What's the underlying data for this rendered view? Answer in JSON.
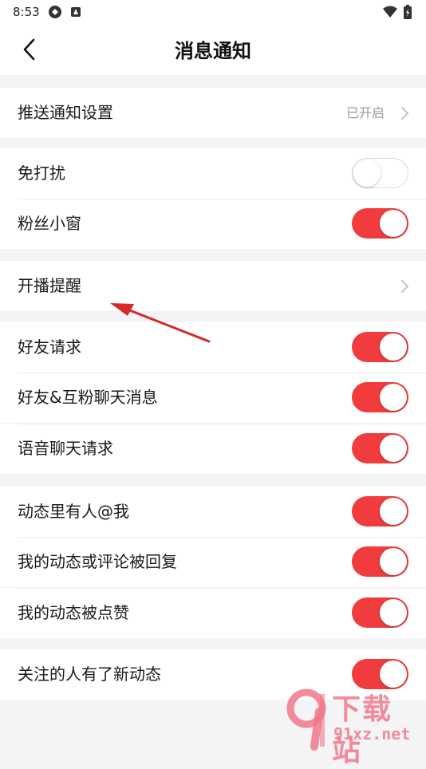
{
  "status_bar": {
    "time": "8:53"
  },
  "header": {
    "title": "消息通知"
  },
  "push_settings": {
    "label": "推送通知设置",
    "value": "已开启"
  },
  "rows": {
    "dnd": {
      "label": "免打扰",
      "on": false
    },
    "fan_window": {
      "label": "粉丝小窗",
      "on": true
    },
    "live_reminder": {
      "label": "开播提醒"
    },
    "friend_request": {
      "label": "好友请求",
      "on": true
    },
    "friend_chat": {
      "label": "好友&互粉聊天消息",
      "on": true
    },
    "voice_request": {
      "label": "语音聊天请求",
      "on": true
    },
    "mention": {
      "label": "动态里有人@我",
      "on": true
    },
    "reply": {
      "label": "我的动态或评论被回复",
      "on": true
    },
    "like": {
      "label": "我的动态被点赞",
      "on": true
    },
    "following_update": {
      "label": "关注的人有了新动态",
      "on": true
    }
  },
  "colors": {
    "accent": "#f03c3c",
    "background": "#f4f4f6",
    "annotation_arrow": "#d42a2a"
  },
  "watermark": {
    "brand": "下载站",
    "url": "91xz.net"
  }
}
